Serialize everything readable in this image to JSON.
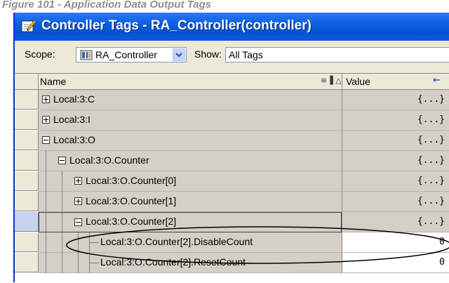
{
  "caption": "Figure 101 - Application Data Output Tags",
  "window": {
    "title": "Controller Tags - RA_Controller(controller)"
  },
  "toolbar": {
    "scope_label": "Scope:",
    "scope_value": "RA_Controller",
    "show_label": "Show:",
    "show_value": "All Tags"
  },
  "grid": {
    "col_name": "Name",
    "col_value": "Value",
    "rows": [
      {
        "name": "Local:3:C",
        "value": "{...}",
        "expander": "plus"
      },
      {
        "name": "Local:3:I",
        "value": "{...}",
        "expander": "plus"
      },
      {
        "name": "Local:3:O",
        "value": "{...}",
        "expander": "minus"
      },
      {
        "name": "Local:3:O.Counter",
        "value": "{...}",
        "expander": "minus"
      },
      {
        "name": "Local:3:O.Counter[0]",
        "value": "{...}",
        "expander": "plus"
      },
      {
        "name": "Local:3:O.Counter[1]",
        "value": "{...}",
        "expander": "plus"
      },
      {
        "name": "Local:3:O.Counter[2]",
        "value": "{...}",
        "expander": "minus"
      },
      {
        "name": "Local:3:O.Counter[2].DisableCount",
        "value": "0",
        "expander": "none"
      },
      {
        "name": "Local:3:O.Counter[2].ResetCount",
        "value": "0",
        "expander": "none"
      }
    ]
  }
}
